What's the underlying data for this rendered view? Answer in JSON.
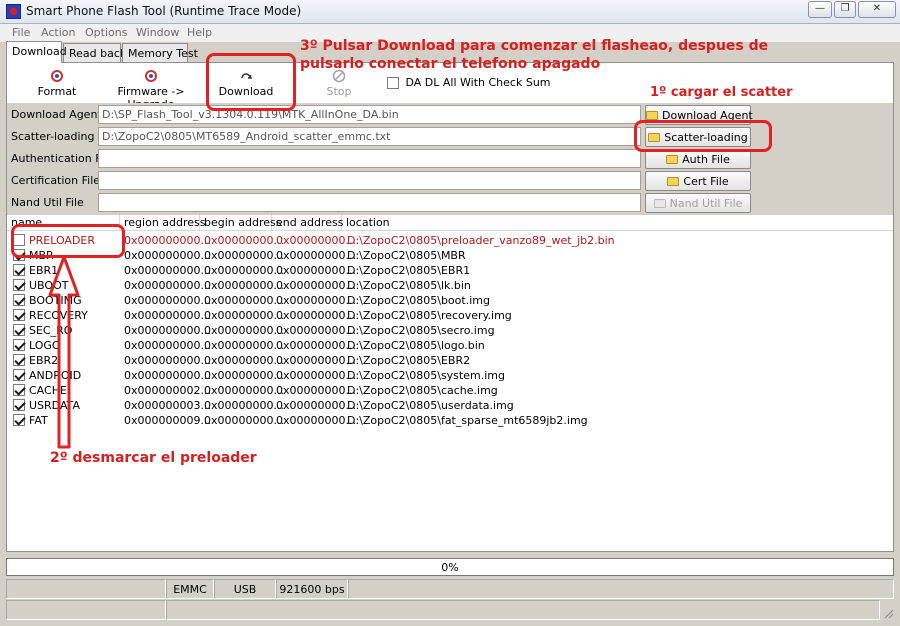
{
  "window": {
    "title": "Smart Phone Flash Tool (Runtime Trace Mode)",
    "controls": [
      "minimize",
      "restore",
      "close"
    ]
  },
  "menu": [
    "File",
    "Action",
    "Options",
    "Window",
    "Help"
  ],
  "tabs": [
    {
      "label": "Download",
      "active": true
    },
    {
      "label": "Read back",
      "active": false
    },
    {
      "label": "Memory Test",
      "active": false
    }
  ],
  "toolbar": {
    "format_label": "Format",
    "firmware_label": "Firmware -> Upgrade",
    "download_label": "Download",
    "stop_label": "Stop",
    "checksum_label": "DA DL All With Check Sum",
    "checksum_checked": false
  },
  "fields": [
    {
      "label": "Download Agent",
      "value": "D:\\SP_Flash_Tool_v3.1304.0.119\\MTK_AllInOne_DA.bin",
      "button": "Download Agent",
      "button_enabled": true
    },
    {
      "label": "Scatter-loading File",
      "value": "D:\\ZopoC2\\0805\\MT6589_Android_scatter_emmc.txt",
      "button": "Scatter-loading",
      "button_enabled": true
    },
    {
      "label": "Authentication File",
      "value": "",
      "button": "Auth File",
      "button_enabled": true
    },
    {
      "label": "Certification File",
      "value": "",
      "button": "Cert File",
      "button_enabled": true
    },
    {
      "label": "Nand Util File",
      "value": "",
      "button": "Nand Util File",
      "button_enabled": false
    }
  ],
  "table": {
    "headers": [
      "name",
      "region address",
      "begin address",
      "end address",
      "location"
    ],
    "rows": [
      {
        "name": "PRELOADER",
        "region": "0x000000000...",
        "begin": "0x00000000...",
        "end": "0x00000000...",
        "location": "D:\\ZopoC2\\0805\\preloader_vanzo89_wet_jb2.bin",
        "checked": false,
        "highlight": true
      },
      {
        "name": "MBR",
        "region": "0x000000000...",
        "begin": "0x00000000...",
        "end": "0x00000000...",
        "location": "D:\\ZopoC2\\0805\\MBR",
        "checked": true,
        "highlight": false
      },
      {
        "name": "EBR1",
        "region": "0x000000000...",
        "begin": "0x00000000...",
        "end": "0x00000000...",
        "location": "D:\\ZopoC2\\0805\\EBR1",
        "checked": true,
        "highlight": false
      },
      {
        "name": "UBOOT",
        "region": "0x000000000...",
        "begin": "0x00000000...",
        "end": "0x00000000...",
        "location": "D:\\ZopoC2\\0805\\lk.bin",
        "checked": true,
        "highlight": false
      },
      {
        "name": "BOOTIMG",
        "region": "0x000000000...",
        "begin": "0x00000000...",
        "end": "0x00000000...",
        "location": "D:\\ZopoC2\\0805\\boot.img",
        "checked": true,
        "highlight": false
      },
      {
        "name": "RECOVERY",
        "region": "0x000000000...",
        "begin": "0x00000000...",
        "end": "0x00000000...",
        "location": "D:\\ZopoC2\\0805\\recovery.img",
        "checked": true,
        "highlight": false
      },
      {
        "name": "SEC_RO",
        "region": "0x000000000...",
        "begin": "0x00000000...",
        "end": "0x00000000...",
        "location": "D:\\ZopoC2\\0805\\secro.img",
        "checked": true,
        "highlight": false
      },
      {
        "name": "LOGO",
        "region": "0x000000000...",
        "begin": "0x00000000...",
        "end": "0x00000000...",
        "location": "D:\\ZopoC2\\0805\\logo.bin",
        "checked": true,
        "highlight": false
      },
      {
        "name": "EBR2",
        "region": "0x000000000...",
        "begin": "0x00000000...",
        "end": "0x00000000...",
        "location": "D:\\ZopoC2\\0805\\EBR2",
        "checked": true,
        "highlight": false
      },
      {
        "name": "ANDROID",
        "region": "0x000000000...",
        "begin": "0x00000000...",
        "end": "0x00000000...",
        "location": "D:\\ZopoC2\\0805\\system.img",
        "checked": true,
        "highlight": false
      },
      {
        "name": "CACHE",
        "region": "0x000000002...",
        "begin": "0x00000000...",
        "end": "0x00000000...",
        "location": "D:\\ZopoC2\\0805\\cache.img",
        "checked": true,
        "highlight": false
      },
      {
        "name": "USRDATA",
        "region": "0x000000003...",
        "begin": "0x00000000...",
        "end": "0x00000000...",
        "location": "D:\\ZopoC2\\0805\\userdata.img",
        "checked": true,
        "highlight": false
      },
      {
        "name": "FAT",
        "region": "0x000000009...",
        "begin": "0x00000000...",
        "end": "0x00000000...",
        "location": "D:\\ZopoC2\\0805\\fat_sparse_mt6589jb2.img",
        "checked": true,
        "highlight": false
      }
    ]
  },
  "progress": {
    "label": "0%",
    "value": 0
  },
  "status": {
    "storage": "EMMC",
    "port": "USB",
    "baud": "921600 bps"
  },
  "annotations": {
    "step3_line1": "3º Pulsar Download para comenzar el flasheao, despues de",
    "step3_line2": "pulsarlo conectar el telefono apagado",
    "step1": "1º cargar el scatter",
    "step2": "2º desmarcar el preloader"
  },
  "colors": {
    "annotation": "#e02222",
    "highlight_row_text": "#b01818",
    "window_bg": "#d4d0c8"
  }
}
